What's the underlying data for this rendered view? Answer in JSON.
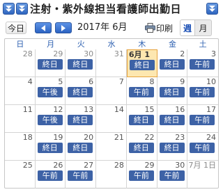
{
  "title": "注射・紫外線担当看護師出勤日",
  "icons": [
    "double-down-arrow-icon",
    "double-down-arrow-icon",
    "double-down-arrow-icon"
  ],
  "toolbar": {
    "today_label": "今日",
    "month_label": "2017年 6月",
    "print_label": "印刷",
    "week_tab": "週",
    "month_tab": "月"
  },
  "colors": {
    "accent": "#2f66c0",
    "event": "#3d62a6",
    "today": "#fde7b0",
    "weekday_header": "#2c5fb0"
  },
  "weekdays": [
    "日",
    "月",
    "火",
    "水",
    "木",
    "金",
    "土"
  ],
  "weeks": [
    [
      {
        "day": "28",
        "other": true,
        "event": ""
      },
      {
        "day": "29",
        "other": true,
        "event": "終日"
      },
      {
        "day": "30",
        "other": true,
        "event": "終日"
      },
      {
        "day": "31",
        "other": true,
        "event": ""
      },
      {
        "day": "6月 1日",
        "other": false,
        "today": true,
        "event": "終日"
      },
      {
        "day": "2",
        "other": false,
        "event": "終日"
      },
      {
        "day": "3",
        "other": false,
        "event": "午前"
      }
    ],
    [
      {
        "day": "4",
        "other": false,
        "event": ""
      },
      {
        "day": "5",
        "other": false,
        "event": "午後"
      },
      {
        "day": "6",
        "other": false,
        "event": "終日"
      },
      {
        "day": "7",
        "other": false,
        "event": ""
      },
      {
        "day": "8",
        "other": false,
        "event": "午前"
      },
      {
        "day": "9",
        "other": false,
        "event": "終日"
      },
      {
        "day": "10",
        "other": false,
        "event": "午前"
      }
    ],
    [
      {
        "day": "11",
        "other": false,
        "event": ""
      },
      {
        "day": "12",
        "other": false,
        "event": "午後"
      },
      {
        "day": "13",
        "other": false,
        "event": "終日"
      },
      {
        "day": "14",
        "other": false,
        "event": ""
      },
      {
        "day": "15",
        "other": false,
        "event": "終日"
      },
      {
        "day": "16",
        "other": false,
        "event": "終日"
      },
      {
        "day": "17",
        "other": false,
        "event": "午前"
      }
    ],
    [
      {
        "day": "18",
        "other": false,
        "event": ""
      },
      {
        "day": "19",
        "other": false,
        "event": "終日"
      },
      {
        "day": "20",
        "other": false,
        "event": "終日"
      },
      {
        "day": "21",
        "other": false,
        "event": ""
      },
      {
        "day": "22",
        "other": false,
        "event": "終日"
      },
      {
        "day": "23",
        "other": false,
        "event": "終日"
      },
      {
        "day": "24",
        "other": false,
        "event": "午前"
      }
    ],
    [
      {
        "day": "25",
        "other": false,
        "event": ""
      },
      {
        "day": "26",
        "other": false,
        "event": "午前"
      },
      {
        "day": "27",
        "other": false,
        "event": "午前"
      },
      {
        "day": "28",
        "other": false,
        "event": ""
      },
      {
        "day": "29",
        "other": false,
        "event": "午前"
      },
      {
        "day": "30",
        "other": false,
        "event": "午前"
      },
      {
        "day": "7月 1日",
        "other": true,
        "event": ""
      }
    ]
  ]
}
